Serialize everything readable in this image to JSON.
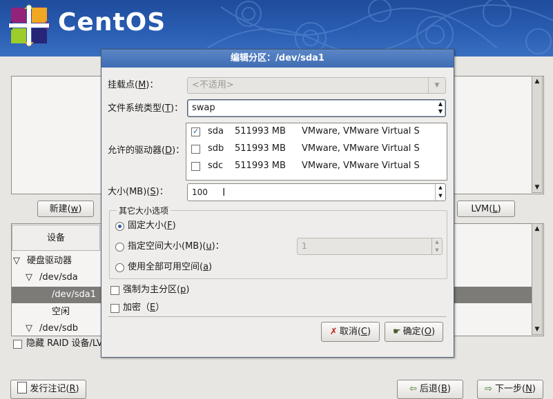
{
  "header": {
    "logo_text": "CentOS"
  },
  "background": {
    "buttons": {
      "new_pre": "新建(",
      "new_key": "w",
      "new_post": ")",
      "lvm_pre": "LVM(",
      "lvm_key": "L",
      "lvm_post": ")"
    },
    "table": {
      "device_header": "设备"
    },
    "tree": [
      {
        "label": "硬盘驱动器",
        "expander": "▽"
      },
      {
        "label": "/dev/sda",
        "expander": "▽"
      },
      {
        "label": "/dev/sda1",
        "selected": true
      },
      {
        "label": "空闲"
      },
      {
        "label": "/dev/sdb",
        "expander": "▽"
      }
    ],
    "hide_raid_label": "隐藏 RAID 设备/LV",
    "bottom": {
      "release_notes_pre": "发行注记(",
      "release_notes_key": "R",
      "release_notes_post": ")",
      "back_pre": "后退(",
      "back_key": "B",
      "back_post": ")",
      "next_pre": "下一步(",
      "next_key": "N",
      "next_post": ")"
    }
  },
  "dialog": {
    "title": "编辑分区：/dev/sda1",
    "mount_point": {
      "label_pre": "挂载点(",
      "label_key": "M",
      "label_post": ")：",
      "value": "<不适用>"
    },
    "fs_type": {
      "label_pre": "文件系统类型(",
      "label_key": "T",
      "label_post": ")：",
      "value": "swap"
    },
    "allowed_drives": {
      "label_pre": "允许的驱动器(",
      "label_key": "D",
      "label_post": ")：",
      "drives": [
        {
          "name": "sda",
          "size": "511993 MB",
          "model": "VMware, VMware Virtual S",
          "checked": true
        },
        {
          "name": "sdb",
          "size": "511993 MB",
          "model": "VMware, VMware Virtual S",
          "checked": false
        },
        {
          "name": "sdc",
          "size": "511993 MB",
          "model": "VMware, VMware Virtual S",
          "checked": false
        }
      ]
    },
    "size": {
      "label_pre": "大小(MB)(",
      "label_key": "S",
      "label_post": ")：",
      "value": "100"
    },
    "size_options": {
      "title": "其它大小选项",
      "fixed": {
        "pre": "固定大小(",
        "key": "F",
        "post": ")",
        "selected": true
      },
      "max": {
        "pre": "指定空间大小(MB)(",
        "key": "u",
        "post": ")：",
        "value": "1",
        "selected": false
      },
      "fill": {
        "pre": "使用全部可用空间(",
        "key": "a",
        "post": ")",
        "selected": false
      }
    },
    "force_primary": {
      "pre": "强制为主分区(",
      "key": "p",
      "post": ")",
      "checked": false
    },
    "encrypt": {
      "pre": "加密（",
      "key": "E",
      "post": "）",
      "checked": false
    },
    "buttons": {
      "cancel_pre": "取消(",
      "cancel_key": "C",
      "cancel_post": ")",
      "ok_pre": "确定(",
      "ok_key": "O",
      "ok_post": ")"
    }
  }
}
